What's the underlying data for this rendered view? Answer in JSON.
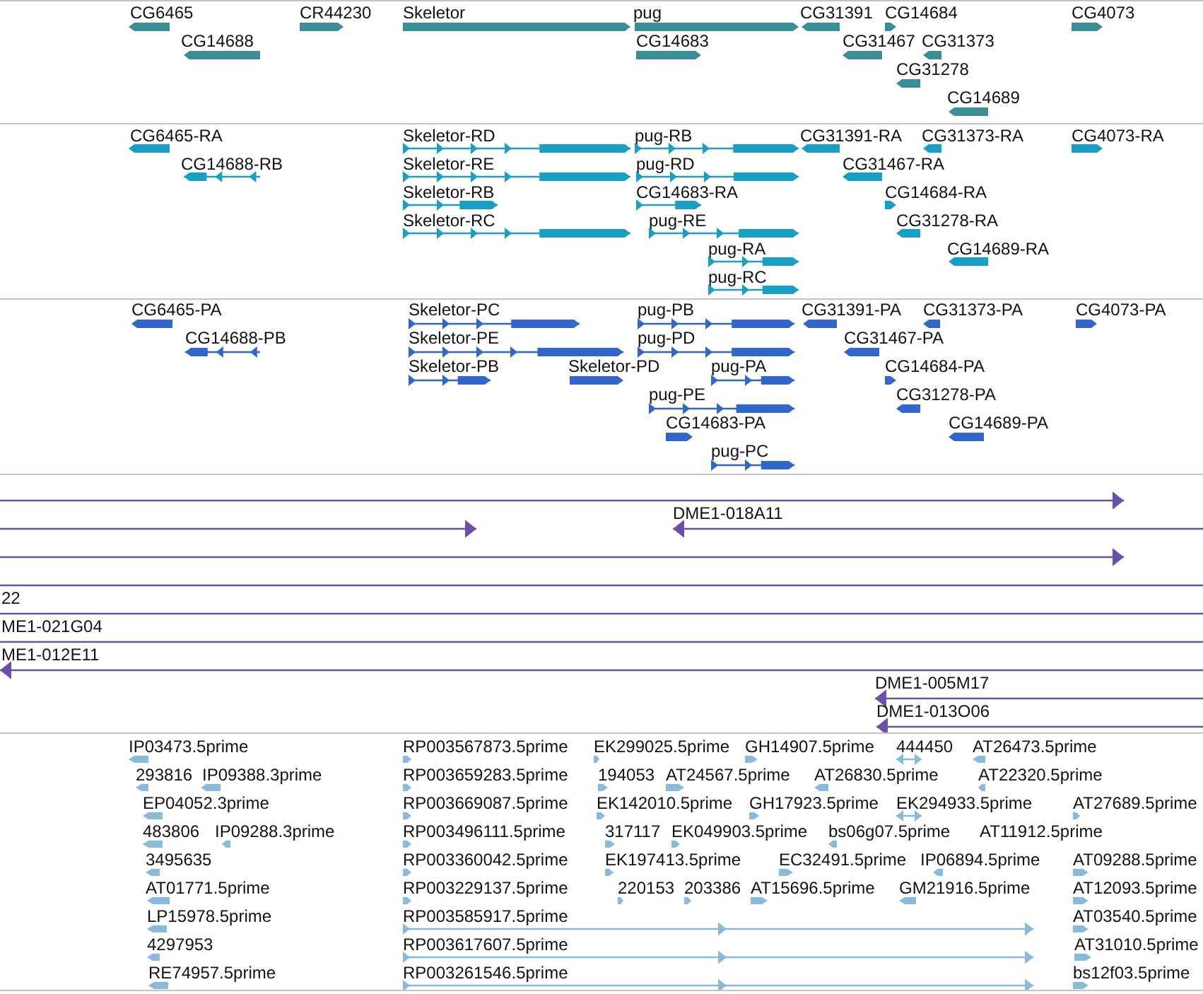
{
  "tracks": [
    {
      "kind": "gene",
      "features": [
        {
          "label": "CG6465",
          "kind": "reverse"
        },
        {
          "label": "CR44230",
          "kind": "forward"
        },
        {
          "label": "Skeletor",
          "kind": "forward"
        },
        {
          "label": "pug",
          "kind": "forward"
        },
        {
          "label": "CG31391",
          "kind": "reverse"
        },
        {
          "label": "CG14684",
          "kind": "forward"
        },
        {
          "label": "CG4073",
          "kind": "forward"
        },
        {
          "label": "CG14688",
          "kind": "reverse"
        },
        {
          "label": "CG14683",
          "kind": "forward"
        },
        {
          "label": "CG31467",
          "kind": "reverse"
        },
        {
          "label": "CG31373",
          "kind": "reverse"
        },
        {
          "label": "CG31278",
          "kind": "reverse"
        },
        {
          "label": "CG14689",
          "kind": "reverse"
        }
      ]
    },
    {
      "kind": "transcript",
      "features": [
        {
          "label": "CG6465-RA",
          "kind": "reverse"
        },
        {
          "label": "Skeletor-RD",
          "kind": "forward"
        },
        {
          "label": "pug-RB",
          "kind": "forward"
        },
        {
          "label": "CG31391-RA",
          "kind": "reverse"
        },
        {
          "label": "CG31373-RA",
          "kind": "reverse"
        },
        {
          "label": "CG4073-RA",
          "kind": "forward"
        },
        {
          "label": "CG14688-RB",
          "kind": "reverse"
        },
        {
          "label": "Skeletor-RE",
          "kind": "forward"
        },
        {
          "label": "pug-RD",
          "kind": "forward"
        },
        {
          "label": "CG31467-RA",
          "kind": "reverse"
        },
        {
          "label": "Skeletor-RB",
          "kind": "forward"
        },
        {
          "label": "CG14683-RA",
          "kind": "forward"
        },
        {
          "label": "CG14684-RA",
          "kind": "forward"
        },
        {
          "label": "Skeletor-RC",
          "kind": "forward"
        },
        {
          "label": "pug-RE",
          "kind": "forward"
        },
        {
          "label": "CG31278-RA",
          "kind": "reverse"
        },
        {
          "label": "pug-RA",
          "kind": "forward"
        },
        {
          "label": "CG14689-RA",
          "kind": "reverse"
        },
        {
          "label": "pug-RC",
          "kind": "forward"
        }
      ]
    },
    {
      "kind": "protein",
      "features": [
        {
          "label": "CG6465-PA",
          "kind": "reverse"
        },
        {
          "label": "Skeletor-PC",
          "kind": "forward"
        },
        {
          "label": "pug-PB",
          "kind": "forward"
        },
        {
          "label": "CG31391-PA",
          "kind": "reverse"
        },
        {
          "label": "CG31373-PA",
          "kind": "reverse"
        },
        {
          "label": "CG4073-PA",
          "kind": "forward"
        },
        {
          "label": "CG14688-PB",
          "kind": "reverse"
        },
        {
          "label": "Skeletor-PE",
          "kind": "forward"
        },
        {
          "label": "pug-PD",
          "kind": "forward"
        },
        {
          "label": "CG31467-PA",
          "kind": "reverse"
        },
        {
          "label": "Skeletor-PB",
          "kind": "forward"
        },
        {
          "label": "Skeletor-PD",
          "kind": "forward"
        },
        {
          "label": "pug-PA",
          "kind": "forward"
        },
        {
          "label": "CG14684-PA",
          "kind": "forward"
        },
        {
          "label": "pug-PE",
          "kind": "forward"
        },
        {
          "label": "CG31278-PA",
          "kind": "reverse"
        },
        {
          "label": "CG14683-PA",
          "kind": "forward"
        },
        {
          "label": "CG14689-PA",
          "kind": "reverse"
        },
        {
          "label": "pug-PC",
          "kind": "forward"
        }
      ]
    },
    {
      "kind": "clone",
      "features": [
        {
          "kind": "forward"
        },
        {
          "label": "DME1-018A11",
          "kind": "reverse"
        },
        {
          "kind": "forward"
        },
        {
          "kind": "forward"
        },
        {
          "kind": "plain"
        },
        {
          "label": "22",
          "kind": "plain"
        },
        {
          "label": "ME1-021G04",
          "kind": "plain"
        },
        {
          "label": "ME1-012E11",
          "kind": "reverse"
        },
        {
          "label": "DME1-005M17",
          "kind": "reverse"
        },
        {
          "label": "DME1-013O06",
          "kind": "reverse"
        }
      ]
    },
    {
      "kind": "est",
      "features": [
        {
          "label": "IP03473.5prime",
          "kind": "reverse"
        },
        {
          "label": "RP003567873.5prime",
          "kind": "forward"
        },
        {
          "label": "EK299025.5prime",
          "kind": "forward"
        },
        {
          "label": "GH14907.5prime",
          "kind": "forward"
        },
        {
          "label": "444450",
          "kind": "both"
        },
        {
          "label": "AT26473.5prime",
          "kind": "reverse"
        },
        {
          "label": "293816",
          "kind": "reverse"
        },
        {
          "label": "IP09388.3prime",
          "kind": "reverse"
        },
        {
          "label": "RP003659283.5prime",
          "kind": "forward"
        },
        {
          "label": "194053",
          "kind": "forward"
        },
        {
          "label": "AT24567.5prime",
          "kind": "forward"
        },
        {
          "label": "AT26830.5prime",
          "kind": "reverse"
        },
        {
          "label": "AT22320.5prime",
          "kind": "reverse"
        },
        {
          "label": "EP04052.3prime",
          "kind": "reverse"
        },
        {
          "label": "RP003669087.5prime",
          "kind": "forward"
        },
        {
          "label": "EK142010.5prime",
          "kind": "forward"
        },
        {
          "label": "GH17923.5prime",
          "kind": "forward"
        },
        {
          "label": "EK294933.5prime",
          "kind": "both"
        },
        {
          "label": "AT27689.5prime",
          "kind": "forward"
        },
        {
          "label": "483806",
          "kind": "reverse"
        },
        {
          "label": "IP09288.3prime",
          "kind": "reverse"
        },
        {
          "label": "RP003496111.5prime",
          "kind": "forward"
        },
        {
          "label": "317117",
          "kind": "forward"
        },
        {
          "label": "EK049903.5prime",
          "kind": "forward"
        },
        {
          "label": "bs06g07.5prime",
          "kind": "reverse"
        },
        {
          "label": "AT11912.5prime"
        },
        {
          "label": "3495635",
          "kind": "reverse"
        },
        {
          "label": "RP003360042.5prime",
          "kind": "forward"
        },
        {
          "label": "EK197413.5prime",
          "kind": "forward"
        },
        {
          "label": "EC32491.5prime",
          "kind": "forward"
        },
        {
          "label": "IP06894.5prime",
          "kind": "reverse"
        },
        {
          "label": "AT09288.5prime",
          "kind": "forward"
        },
        {
          "label": "AT01771.5prime",
          "kind": "reverse"
        },
        {
          "label": "RP003229137.5prime",
          "kind": "forward"
        },
        {
          "label": "220153",
          "kind": "forward"
        },
        {
          "label": "203386",
          "kind": "forward"
        },
        {
          "label": "AT15696.5prime",
          "kind": "forward"
        },
        {
          "label": "GM21916.5prime",
          "kind": "reverse"
        },
        {
          "label": "AT12093.5prime",
          "kind": "forward"
        },
        {
          "label": "LP15978.5prime",
          "kind": "reverse"
        },
        {
          "label": "RP003585917.5prime",
          "kind": "forward"
        },
        {
          "label": "AT03540.5prime",
          "kind": "forward"
        },
        {
          "label": "4297953",
          "kind": "reverse"
        },
        {
          "label": "RP003617607.5prime",
          "kind": "forward"
        },
        {
          "label": "AT31010.5prime",
          "kind": "forward"
        },
        {
          "label": "RE74957.5prime",
          "kind": "reverse"
        },
        {
          "label": "RP003261546.5prime",
          "kind": "forward"
        },
        {
          "label": "bs12f03.5prime",
          "kind": "forward"
        }
      ]
    }
  ]
}
